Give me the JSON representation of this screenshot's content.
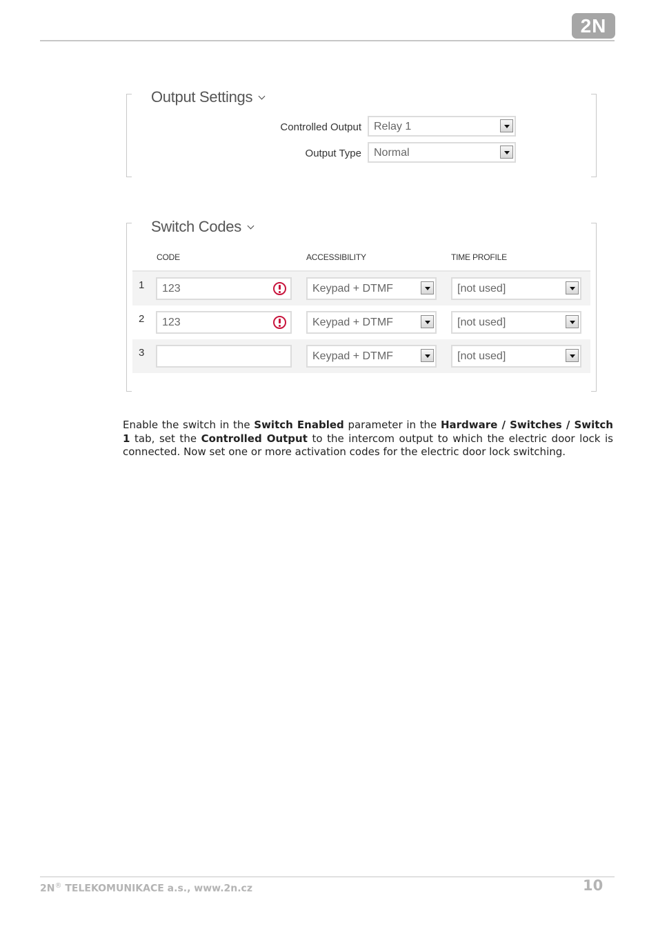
{
  "header": {
    "logo_text": "2N"
  },
  "output_settings": {
    "title": "Output Settings",
    "fields": [
      {
        "label": "Controlled Output",
        "value": "Relay 1"
      },
      {
        "label": "Output Type",
        "value": "Normal"
      }
    ]
  },
  "switch_codes": {
    "title": "Switch Codes",
    "columns": [
      "CODE",
      "ACCESSIBILITY",
      "TIME PROFILE"
    ],
    "rows": [
      {
        "index": "1",
        "code": "123",
        "code_warning": true,
        "accessibility": "Keypad + DTMF",
        "time_profile": "[not used]"
      },
      {
        "index": "2",
        "code": "123",
        "code_warning": true,
        "accessibility": "Keypad + DTMF",
        "time_profile": "[not used]"
      },
      {
        "index": "3",
        "code": "",
        "code_warning": false,
        "accessibility": "Keypad + DTMF",
        "time_profile": "[not used]"
      }
    ]
  },
  "body_text": {
    "t1": "Enable the switch in the ",
    "b1": "Switch Enabled",
    "t2": " parameter in the ",
    "b2": "Hardware / Switches / Switch 1",
    "t3": " tab, set the ",
    "b3": "Controlled Output",
    "t4": " to the intercom output to which the electric door lock is connected. Now set one or more activation codes for the electric door lock switching."
  },
  "footer": {
    "company_prefix": "2N",
    "registered": "®",
    "company_rest": " TELEKOMUNIKACE a.s., www.2n.cz",
    "page_number": "10"
  },
  "colors": {
    "warning": "#c8143c",
    "footer_gray": "#b4b4b4"
  }
}
